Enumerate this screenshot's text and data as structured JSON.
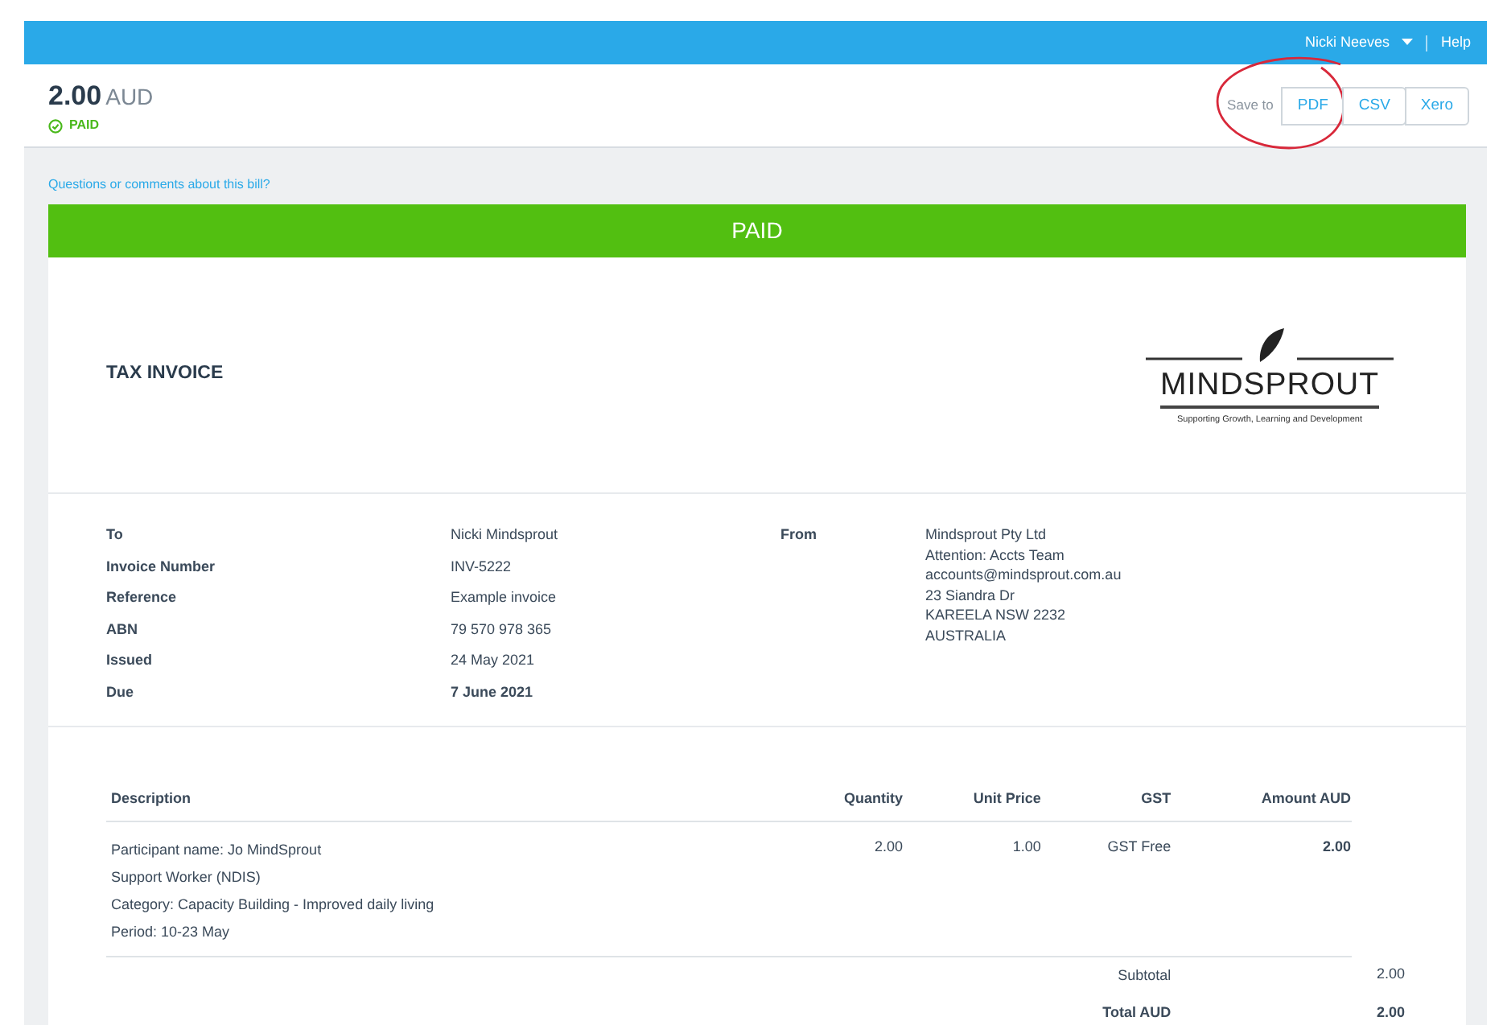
{
  "navbar": {
    "user": "Nicki Neeves",
    "help": "Help"
  },
  "summary": {
    "amount": "2.00",
    "currency": "AUD",
    "status": "PAID"
  },
  "save_to": {
    "label": "Save to",
    "buttons": [
      {
        "label": "PDF",
        "circled": true
      },
      {
        "label": "CSV",
        "circled": false
      },
      {
        "label": "Xero",
        "circled": false
      }
    ]
  },
  "questions_link": "Questions or comments about this bill?",
  "status_banner": "PAID",
  "invoice": {
    "title": "TAX INVOICE",
    "logo": {
      "name": "MINDSPROUT",
      "tagline": "Supporting Growth, Learning and Development"
    },
    "details": [
      {
        "label": "To",
        "value": "Nicki Mindsprout",
        "bold": false
      },
      {
        "label": "Invoice Number",
        "value": "INV-5222",
        "bold": false
      },
      {
        "label": "Reference",
        "value": "Example invoice",
        "bold": false
      },
      {
        "label": "ABN",
        "value": "79 570 978 365",
        "bold": false
      },
      {
        "label": "Issued",
        "value": "24 May 2021",
        "bold": false
      },
      {
        "label": "Due",
        "value": "7 June 2021",
        "bold": true
      }
    ],
    "from": {
      "label": "From",
      "lines": [
        "Mindsprout Pty Ltd",
        "Attention: Accts Team",
        "accounts@mindsprout.com.au",
        "23 Siandra Dr",
        "KAREELA NSW 2232",
        "AUSTRALIA"
      ]
    },
    "table": {
      "columns": [
        "Description",
        "Quantity",
        "Unit Price",
        "GST",
        "Amount AUD"
      ],
      "rows": [
        {
          "description": [
            "Participant name: Jo MindSprout",
            "Support Worker (NDIS)",
            "Category: Capacity Building - Improved daily living",
            "Period: 10-23 May"
          ],
          "quantity": "2.00",
          "unit_price": "1.00",
          "gst": "GST Free",
          "amount": "2.00"
        }
      ]
    },
    "totals": [
      {
        "label": "Subtotal",
        "value": "2.00",
        "bold": false
      },
      {
        "label": "Total AUD",
        "value": "2.00",
        "bold": true
      }
    ]
  }
}
